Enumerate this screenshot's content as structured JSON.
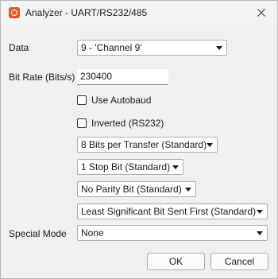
{
  "window": {
    "title": "Analyzer - UART/RS232/485",
    "icons": {
      "app": "app-logo-icon",
      "close": "close-icon"
    }
  },
  "form": {
    "data_label": "Data",
    "data_value": "9 - 'Channel 9'",
    "bit_rate_label": "Bit Rate (Bits/s)",
    "bit_rate_value": "230400",
    "autobaud_label": "Use Autobaud",
    "autobaud_checked": false,
    "inverted_label": "Inverted (RS232)",
    "inverted_checked": false,
    "bits_per_transfer": "8 Bits per Transfer (Standard)",
    "stop_bits": "1 Stop Bit (Standard)",
    "parity": "No Parity Bit (Standard)",
    "bit_order": "Least Significant Bit Sent First (Standard)",
    "special_mode_label": "Special Mode",
    "special_mode_value": "None"
  },
  "buttons": {
    "ok": "OK",
    "cancel": "Cancel"
  }
}
